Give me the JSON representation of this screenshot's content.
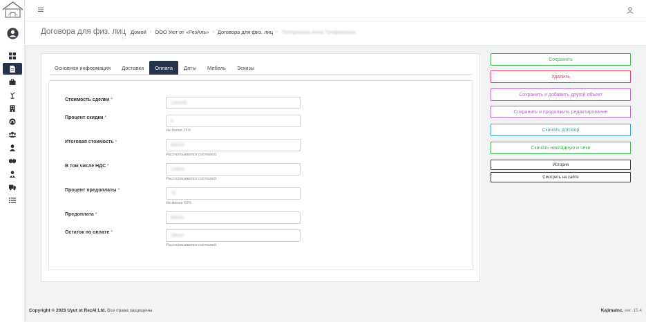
{
  "header": {
    "page_title": "Договора для физ. лиц"
  },
  "breadcrumb": {
    "items": [
      "Домой",
      "ООО Уют от «РезАль»",
      "Договора для физ. лиц",
      "Потеряхина Анна Трофимовна"
    ]
  },
  "tabs": [
    {
      "label": "Основная информация",
      "active": false
    },
    {
      "label": "Доставка",
      "active": false
    },
    {
      "label": "Оплата",
      "active": true
    },
    {
      "label": "Даты",
      "active": false
    },
    {
      "label": "Мебель",
      "active": false
    },
    {
      "label": "Эскизы",
      "active": false
    }
  ],
  "fields": [
    {
      "label": "Стоимость сделки",
      "required": "*",
      "value": "100000",
      "help": ""
    },
    {
      "label": "Процент скидки",
      "required": "*",
      "value": "5",
      "help": "Не более 25%"
    },
    {
      "label": "Итоговая стоимость",
      "required": "*",
      "value": "95000",
      "help": "Рассчитывается системой"
    },
    {
      "label": "В том числе НДС",
      "required": "*",
      "value": "15833",
      "help": "Рассчитывается системой"
    },
    {
      "label": "Процент предоплаты",
      "required": "*",
      "value": "70",
      "help": "Не менее 60%"
    },
    {
      "label": "Предоплата",
      "required": "*",
      "value": "66500",
      "help": ""
    },
    {
      "label": "Остаток по оплате",
      "required": "*",
      "value": "28500",
      "help": "Рассчитывается системой"
    }
  ],
  "actions": [
    {
      "label": "Сохранить",
      "color": "#3cb44b",
      "text_color": "#3cb44b"
    },
    {
      "label": "Удалить",
      "color": "#e83a5a",
      "text_color": "#e83a5a"
    },
    {
      "label": "Сохранить и добавить другой объект",
      "color": "#b565c9",
      "text_color": "#b565c9"
    },
    {
      "label": "Сохранить и продолжить редактирование",
      "color": "#b565c9",
      "text_color": "#b565c9"
    },
    {
      "label": "Скачать договор",
      "color": "#3a9fc9",
      "text_color": "#3a9fc9"
    },
    {
      "label": "Скачать накладную и чеки",
      "color": "#3cb44b",
      "text_color": "#3cb44b"
    },
    {
      "label": "История",
      "color": "#333333",
      "text_color": "#333333"
    },
    {
      "label": "Смотреть на сайте",
      "color": "#333333",
      "text_color": "#333333"
    }
  ],
  "sidebar": {
    "items": [
      {
        "icon": "dashboard-icon",
        "active": false
      },
      {
        "icon": "document-icon",
        "active": true
      },
      {
        "icon": "briefcase-icon",
        "active": false
      },
      {
        "icon": "lamp-icon",
        "active": false
      },
      {
        "icon": "building-icon",
        "active": false
      },
      {
        "icon": "headset-icon",
        "active": false
      },
      {
        "icon": "users-icon",
        "active": false
      },
      {
        "icon": "user-icon",
        "active": false
      },
      {
        "icon": "handshake-icon",
        "active": false
      },
      {
        "icon": "user-tie-icon",
        "active": false
      },
      {
        "icon": "truck-icon",
        "active": false
      },
      {
        "icon": "list-icon",
        "active": false
      }
    ]
  },
  "footer": {
    "copyright_prefix": "Copyright © 2023 Uyut ot RezAl Ltd.",
    "copyright_suffix": "Все права защищены.",
    "company": "KajimaInc.",
    "version": "ver. 15.4"
  },
  "colors": {
    "primary_dark": "#27334a",
    "required": "#d9534f"
  }
}
